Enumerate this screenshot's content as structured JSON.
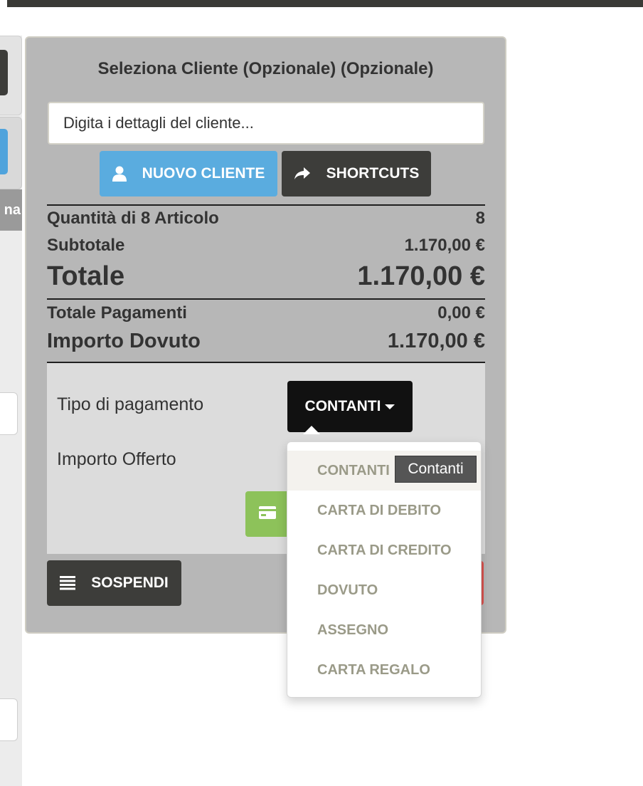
{
  "left_strip": {
    "tag_text": "na"
  },
  "panel": {
    "title": "Seleziona Cliente (Opzionale) (Opzionale)",
    "customer_placeholder": "Digita i dettagli del cliente...",
    "new_customer_label": "NUOVO CLIENTE",
    "shortcuts_label": "SHORTCUTS"
  },
  "summary": {
    "items_label": "Quantità di 8 Articolo",
    "items_value": "8",
    "subtotal_label": "Subtotale",
    "subtotal_value": "1.170,00 €",
    "total_label": "Totale",
    "total_value": "1.170,00 €",
    "payments_label": "Totale Pagamenti",
    "payments_value": "0,00 €",
    "due_label": "Importo Dovuto",
    "due_value": "1.170,00 €"
  },
  "payment": {
    "type_label": "Tipo di pagamento",
    "type_selected": "CONTANTI",
    "offered_label": "Importo Offerto",
    "options": [
      "CONTANTI",
      "CARTA DI DEBITO",
      "CARTA DI CREDITO",
      "DOVUTO",
      "ASSEGNO",
      "CARTA REGALO"
    ],
    "tooltip": "Contanti"
  },
  "footer": {
    "suspend_label": "SOSPENDI"
  },
  "colors": {
    "accent_blue": "#5aacdf",
    "dark_button": "#3d3d3a",
    "green_button": "#8dc25a",
    "danger_red": "#d9534f"
  },
  "icons": {
    "new_customer": "user-icon",
    "shortcuts": "share-arrow-icon",
    "suspend": "list-icon",
    "card": "credit-card-icon"
  }
}
